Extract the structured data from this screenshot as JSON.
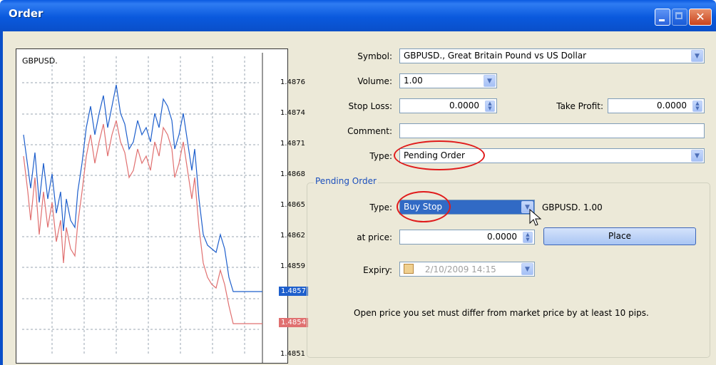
{
  "window": {
    "title": "Order"
  },
  "chart": {
    "symbol": "GBPUSD.",
    "price_labels": [
      "1.4876",
      "1.4874",
      "1.4871",
      "1.4868",
      "1.4865",
      "1.4862",
      "1.4859",
      "1.4857",
      "1.4854",
      "1.4851"
    ],
    "bid_label": "1.4857",
    "ask_label": "1.4854",
    "colors": {
      "bid": "#1e5fcc",
      "ask": "#e07070"
    }
  },
  "form": {
    "symbol_label": "Symbol:",
    "symbol_value": "GBPUSD., Great Britain Pound vs US Dollar",
    "volume_label": "Volume:",
    "volume_value": "1.00",
    "stoploss_label": "Stop Loss:",
    "stoploss_value": "0.0000",
    "takeprofit_label": "Take Profit:",
    "takeprofit_value": "0.0000",
    "comment_label": "Comment:",
    "comment_value": "",
    "type_label": "Type:",
    "type_value": "Pending Order"
  },
  "pending": {
    "group_title": "Pending Order",
    "type_label": "Type:",
    "type_value": "Buy Stop",
    "summary": "GBPUSD.  1.00",
    "price_label": "at price:",
    "price_value": "0.0000",
    "place_button": "Place",
    "expiry_label": "Expiry:",
    "expiry_value": "2/10/2009 14:15",
    "note": "Open price you set must differ from market price by at least 10 pips."
  }
}
